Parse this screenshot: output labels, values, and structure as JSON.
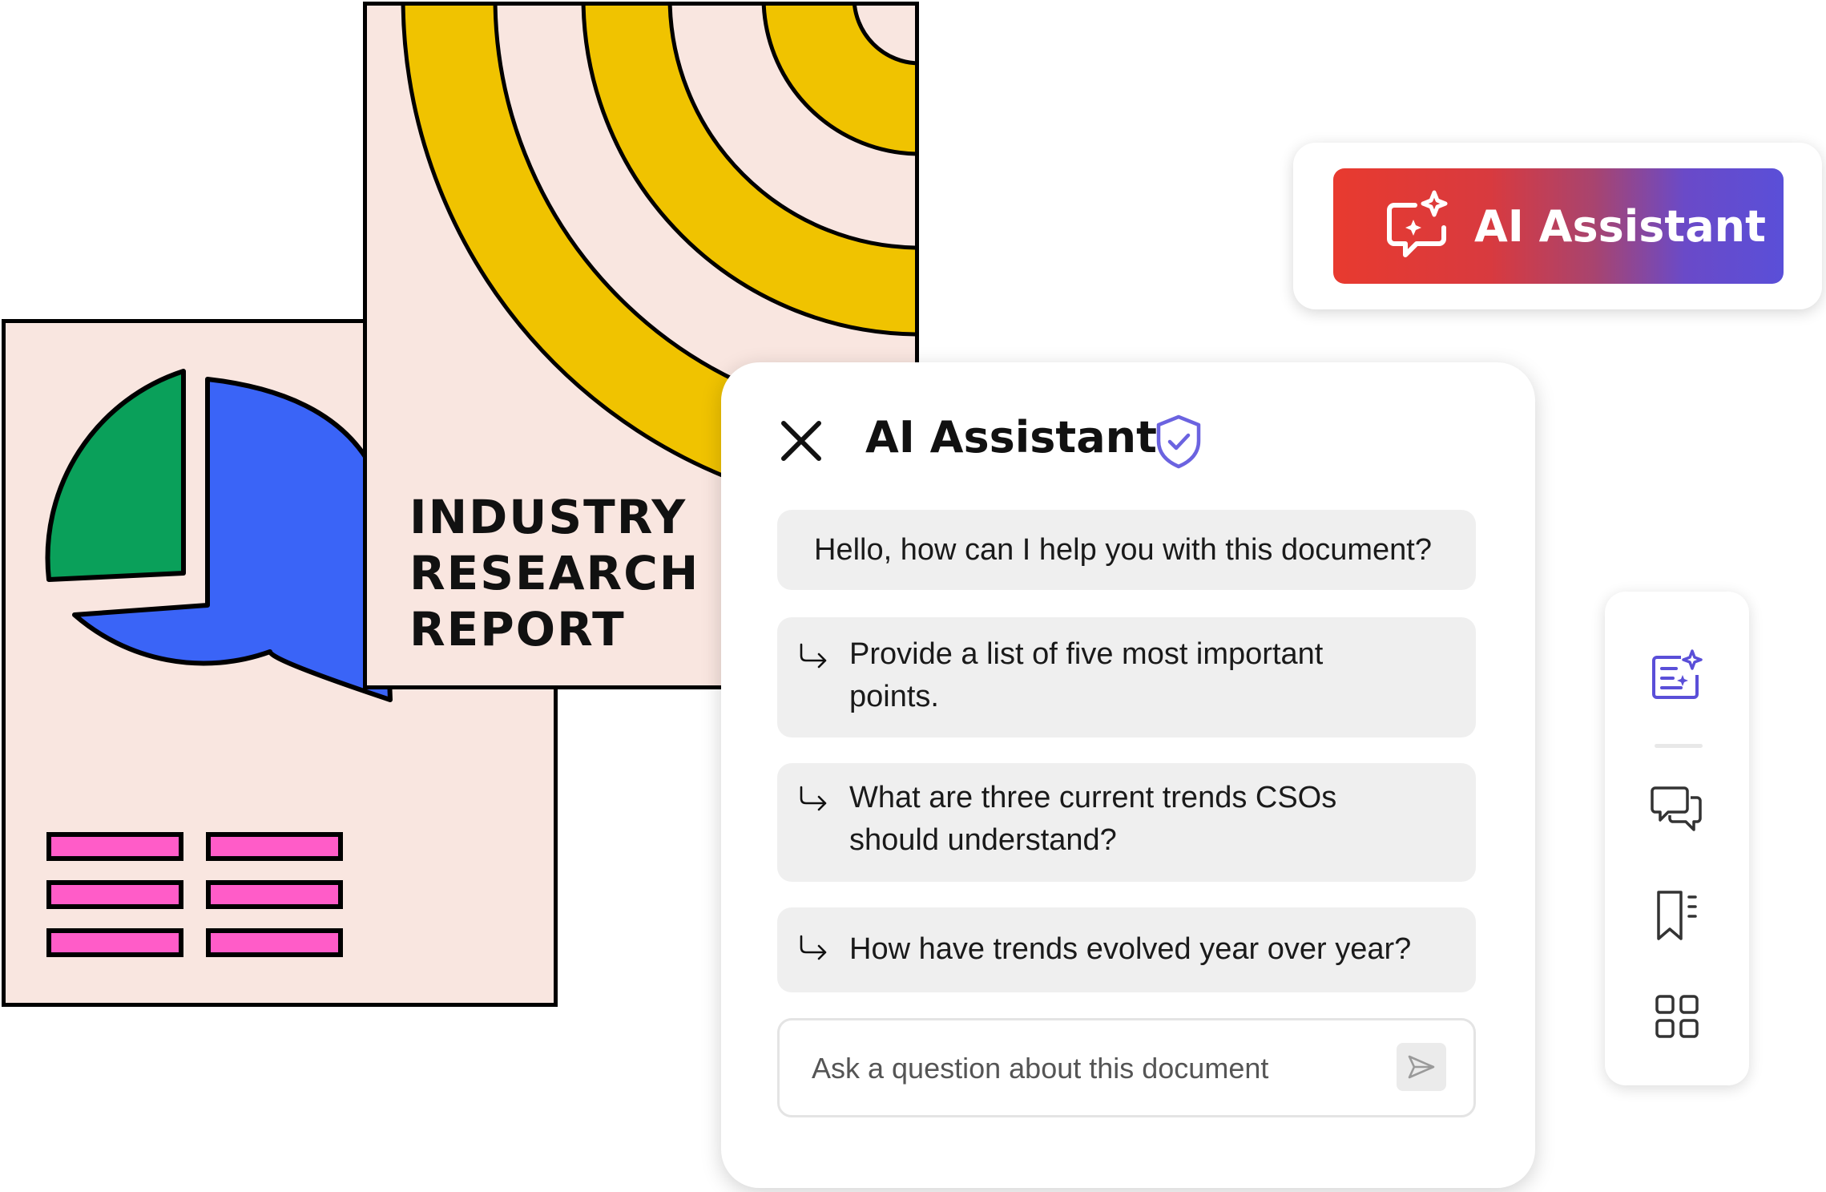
{
  "illustration": {
    "report_title_lines": [
      "INDUSTRY",
      "RESEARCH",
      "REPORT"
    ],
    "colors": {
      "paper": "#f9e6e0",
      "yellow": "#f0c300",
      "green": "#0aa05a",
      "blue": "#3a64f7",
      "pink": "#ff5cc8"
    }
  },
  "ai_button": {
    "label": "AI Assistant",
    "icon": "chat-sparkle-icon"
  },
  "chat_panel": {
    "title": "AI Assistant",
    "close_icon": "close-icon",
    "title_icon": "shield-check-icon",
    "greeting": "Hello, how can I help you with this document?",
    "suggestions": [
      {
        "line1": "Provide a list of five most important",
        "line2": "points."
      },
      {
        "line1": "What are three current trends CSOs",
        "line2": "should understand?"
      },
      {
        "line1": "How have trends evolved year over year?",
        "line2": ""
      }
    ],
    "input": {
      "placeholder": "Ask a question about this document",
      "value": ""
    },
    "send_icon": "send-icon"
  },
  "side_rail": {
    "icons": [
      "ai-summary-icon",
      "comments-icon",
      "bookmarks-icon",
      "grid-icon"
    ],
    "accent": "#5a4fd8"
  }
}
